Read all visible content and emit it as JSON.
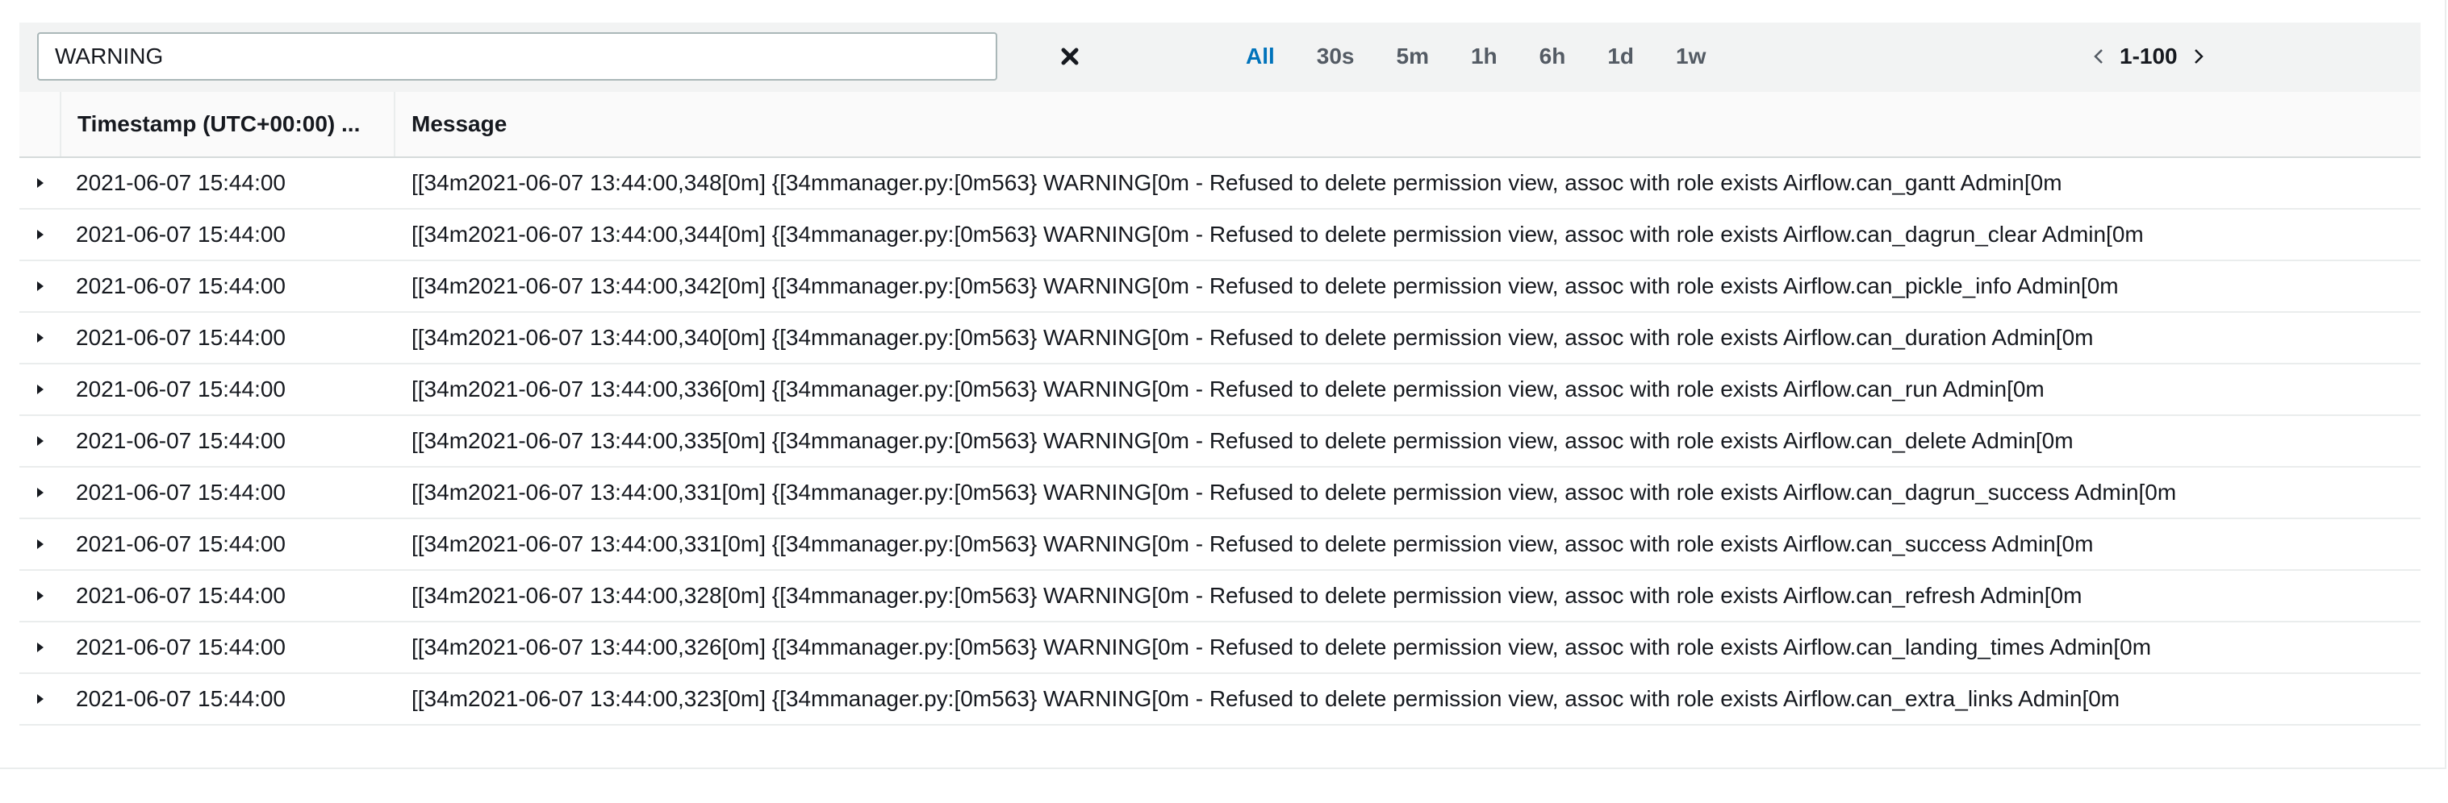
{
  "filter": {
    "search_value": "WARNING",
    "clear_icon": "close-icon"
  },
  "time_filters": [
    {
      "label": "All",
      "active": true
    },
    {
      "label": "30s",
      "active": false
    },
    {
      "label": "5m",
      "active": false
    },
    {
      "label": "1h",
      "active": false
    },
    {
      "label": "6h",
      "active": false
    },
    {
      "label": "1d",
      "active": false
    },
    {
      "label": "1w",
      "active": false
    }
  ],
  "pager": {
    "range": "1-100",
    "prev_icon": "chevron-left-icon",
    "next_icon": "chevron-right-icon"
  },
  "table": {
    "columns": [
      "Timestamp (UTC+00:00) ...",
      "Message"
    ],
    "rows": [
      {
        "timestamp": "2021-06-07 15:44:00",
        "message": "[[34m2021-06-07 13:44:00,348[0m] {[34mmanager.py:[0m563} WARNING[0m - Refused to delete permission view, assoc with role exists Airflow.can_gantt Admin[0m"
      },
      {
        "timestamp": "2021-06-07 15:44:00",
        "message": "[[34m2021-06-07 13:44:00,344[0m] {[34mmanager.py:[0m563} WARNING[0m - Refused to delete permission view, assoc with role exists Airflow.can_dagrun_clear Admin[0m"
      },
      {
        "timestamp": "2021-06-07 15:44:00",
        "message": "[[34m2021-06-07 13:44:00,342[0m] {[34mmanager.py:[0m563} WARNING[0m - Refused to delete permission view, assoc with role exists Airflow.can_pickle_info Admin[0m"
      },
      {
        "timestamp": "2021-06-07 15:44:00",
        "message": "[[34m2021-06-07 13:44:00,340[0m] {[34mmanager.py:[0m563} WARNING[0m - Refused to delete permission view, assoc with role exists Airflow.can_duration Admin[0m"
      },
      {
        "timestamp": "2021-06-07 15:44:00",
        "message": "[[34m2021-06-07 13:44:00,336[0m] {[34mmanager.py:[0m563} WARNING[0m - Refused to delete permission view, assoc with role exists Airflow.can_run Admin[0m"
      },
      {
        "timestamp": "2021-06-07 15:44:00",
        "message": "[[34m2021-06-07 13:44:00,335[0m] {[34mmanager.py:[0m563} WARNING[0m - Refused to delete permission view, assoc with role exists Airflow.can_delete Admin[0m"
      },
      {
        "timestamp": "2021-06-07 15:44:00",
        "message": "[[34m2021-06-07 13:44:00,331[0m] {[34mmanager.py:[0m563} WARNING[0m - Refused to delete permission view, assoc with role exists Airflow.can_dagrun_success Admin[0m"
      },
      {
        "timestamp": "2021-06-07 15:44:00",
        "message": "[[34m2021-06-07 13:44:00,331[0m] {[34mmanager.py:[0m563} WARNING[0m - Refused to delete permission view, assoc with role exists Airflow.can_success Admin[0m"
      },
      {
        "timestamp": "2021-06-07 15:44:00",
        "message": "[[34m2021-06-07 13:44:00,328[0m] {[34mmanager.py:[0m563} WARNING[0m - Refused to delete permission view, assoc with role exists Airflow.can_refresh Admin[0m"
      },
      {
        "timestamp": "2021-06-07 15:44:00",
        "message": "[[34m2021-06-07 13:44:00,326[0m] {[34mmanager.py:[0m563} WARNING[0m - Refused to delete permission view, assoc with role exists Airflow.can_landing_times Admin[0m"
      },
      {
        "timestamp": "2021-06-07 15:44:00",
        "message": "[[34m2021-06-07 13:44:00,323[0m] {[34mmanager.py:[0m563} WARNING[0m - Refused to delete permission view, assoc with role exists Airflow.can_extra_links Admin[0m"
      }
    ]
  },
  "colors": {
    "accent": "#0073bb",
    "text": "#16191f",
    "toolbar_bg": "#f2f3f3",
    "border": "#d5dbdb"
  }
}
